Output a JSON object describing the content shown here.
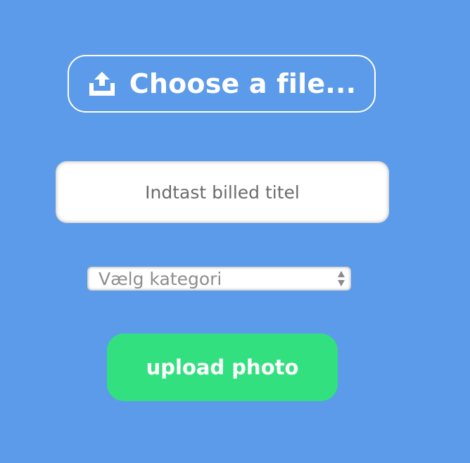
{
  "file_picker": {
    "label": "Choose a file...",
    "icon": "upload-icon"
  },
  "title_input": {
    "value": "",
    "placeholder": "Indtast billed titel"
  },
  "category_select": {
    "selected": "Vælg kategori",
    "icon": "select-arrows-icon"
  },
  "submit": {
    "label": "upload photo"
  },
  "colors": {
    "background": "#5b9bea",
    "accent_green": "#33e07f",
    "white": "#ffffff"
  }
}
